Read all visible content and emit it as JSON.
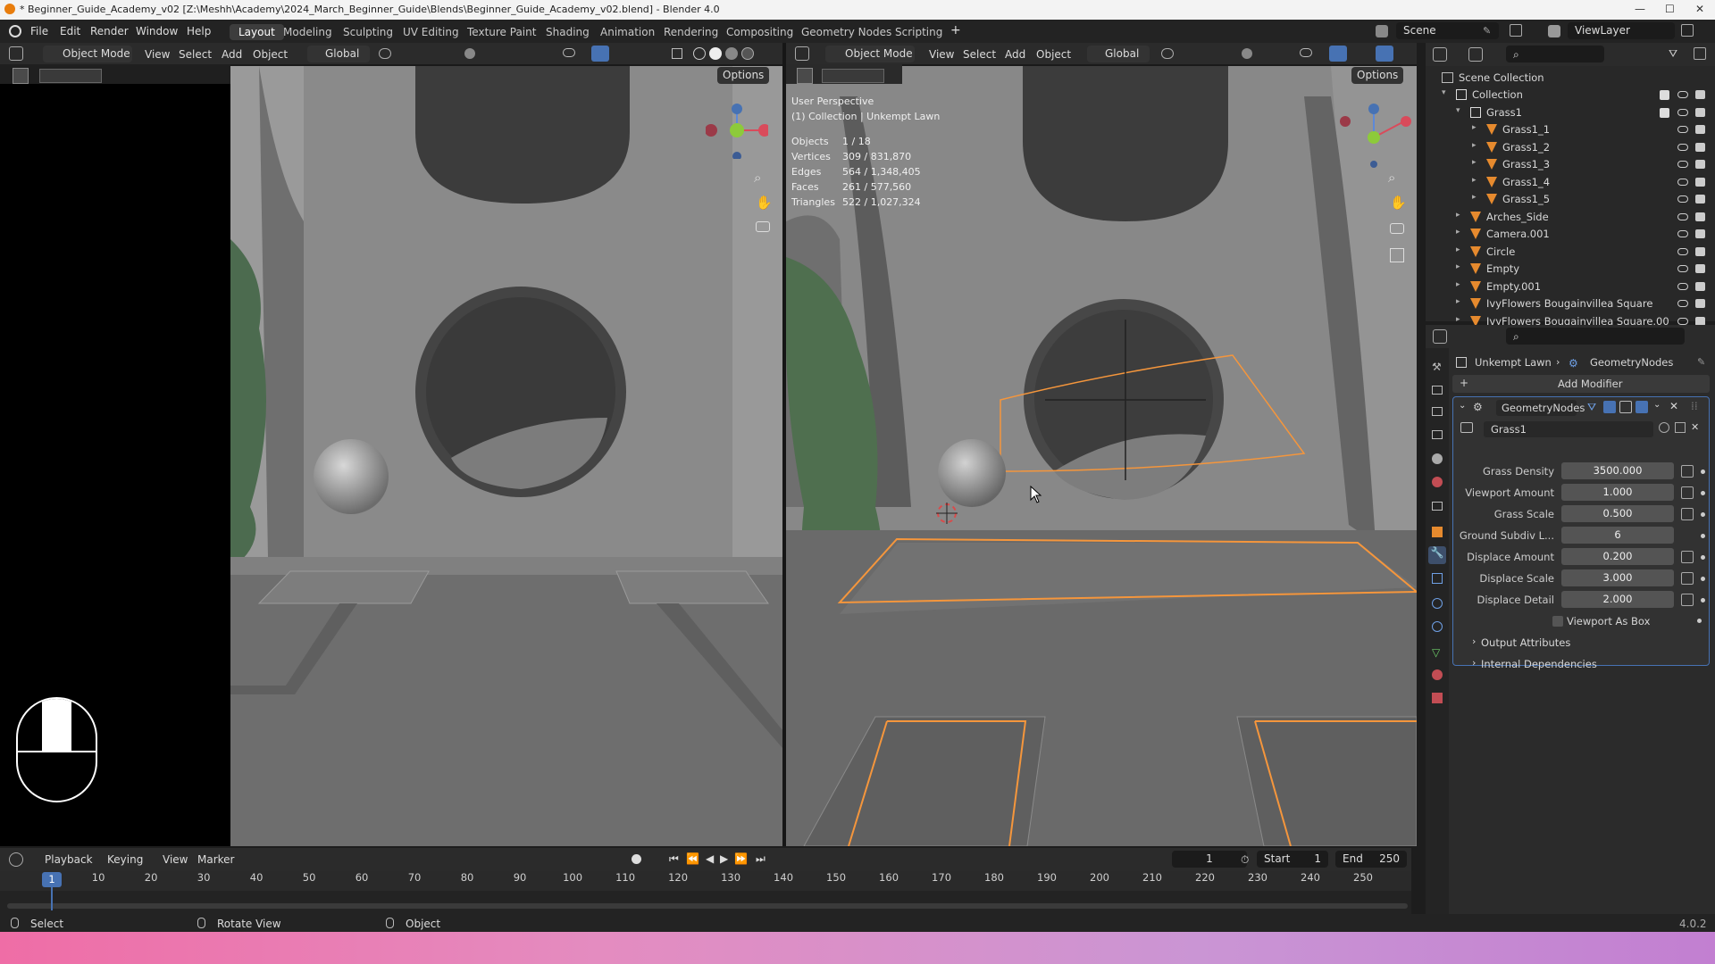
{
  "titlebar": {
    "title": "* Beginner_Guide_Academy_v02 [Z:\\Meshh\\Academy\\2024_March_Beginner_Guide\\Blends\\Beginner_Guide_Academy_v02.blend] - Blender 4.0"
  },
  "menu": {
    "file": "File",
    "edit": "Edit",
    "render": "Render",
    "window": "Window",
    "help": "Help"
  },
  "workspaces": [
    "Layout",
    "Modeling",
    "Sculpting",
    "UV Editing",
    "Texture Paint",
    "Shading",
    "Animation",
    "Rendering",
    "Compositing",
    "Geometry Nodes",
    "Scripting"
  ],
  "scene": {
    "scene_name": "Scene",
    "view_layer": "ViewLayer"
  },
  "viewport_header": {
    "mode": "Object Mode",
    "view": "View",
    "select": "Select",
    "add": "Add",
    "object": "Object",
    "orientation": "Global",
    "options": "Options"
  },
  "overlay": {
    "perspective": "User Perspective",
    "collection": "(1) Collection | Unkempt Lawn",
    "stats": [
      {
        "label": "Objects",
        "value": "1 / 18"
      },
      {
        "label": "Vertices",
        "value": "309 / 831,870"
      },
      {
        "label": "Edges",
        "value": "564 / 1,348,405"
      },
      {
        "label": "Faces",
        "value": "261 / 577,560"
      },
      {
        "label": "Triangles",
        "value": "522 / 1,027,324"
      }
    ]
  },
  "outliner": {
    "root": "Scene Collection",
    "items": [
      {
        "label": "Collection",
        "level": 1
      },
      {
        "label": "Grass1",
        "level": 2
      },
      {
        "label": "Grass1_1",
        "level": 3
      },
      {
        "label": "Grass1_2",
        "level": 3
      },
      {
        "label": "Grass1_3",
        "level": 3
      },
      {
        "label": "Grass1_4",
        "level": 3
      },
      {
        "label": "Grass1_5",
        "level": 3
      },
      {
        "label": "Arches_Side",
        "level": 2
      },
      {
        "label": "Camera.001",
        "level": 2
      },
      {
        "label": "Circle",
        "level": 2
      },
      {
        "label": "Empty",
        "level": 2
      },
      {
        "label": "Empty.001",
        "level": 2
      },
      {
        "label": "IvyFlowers Bougainvillea Square",
        "level": 2
      },
      {
        "label": "IvyFlowers Bougainvillea Square.00",
        "level": 2
      }
    ]
  },
  "properties": {
    "breadcrumb_object": "Unkempt Lawn",
    "breadcrumb_modifier": "GeometryNodes",
    "add_modifier": "Add Modifier",
    "modifier_name": "GeometryNodes",
    "node_group": "Grass1",
    "fields": [
      {
        "label": "Grass Density",
        "value": "3500.000"
      },
      {
        "label": "Viewport Amount",
        "value": "1.000"
      },
      {
        "label": "Grass Scale",
        "value": "0.500"
      },
      {
        "label": "Ground Subdiv L...",
        "value": "6"
      },
      {
        "label": "Displace Amount",
        "value": "0.200"
      },
      {
        "label": "Displace Scale",
        "value": "3.000"
      },
      {
        "label": "Displace Detail",
        "value": "2.000"
      }
    ],
    "checkbox_label": "Viewport As Box",
    "output_attributes": "Output Attributes",
    "internal_dependencies": "Internal Dependencies"
  },
  "timeline": {
    "playback": "Playback",
    "keying": "Keying",
    "view": "View",
    "marker": "Marker",
    "current_frame": "1",
    "start_label": "Start",
    "start": "1",
    "end_label": "End",
    "end": "250",
    "ticks": [
      "10",
      "20",
      "30",
      "40",
      "50",
      "60",
      "70",
      "80",
      "90",
      "100",
      "110",
      "120",
      "130",
      "140",
      "150",
      "160",
      "170",
      "180",
      "190",
      "200",
      "210",
      "220",
      "230",
      "240",
      "250"
    ],
    "playhead": "1"
  },
  "statusbar": {
    "select": "Select",
    "rotate": "Rotate View",
    "object": "Object",
    "version": "4.0.2"
  },
  "colors": {
    "accent": "#4772b3",
    "selection": "#f5963c",
    "active_tab": "#3d3d3d"
  }
}
